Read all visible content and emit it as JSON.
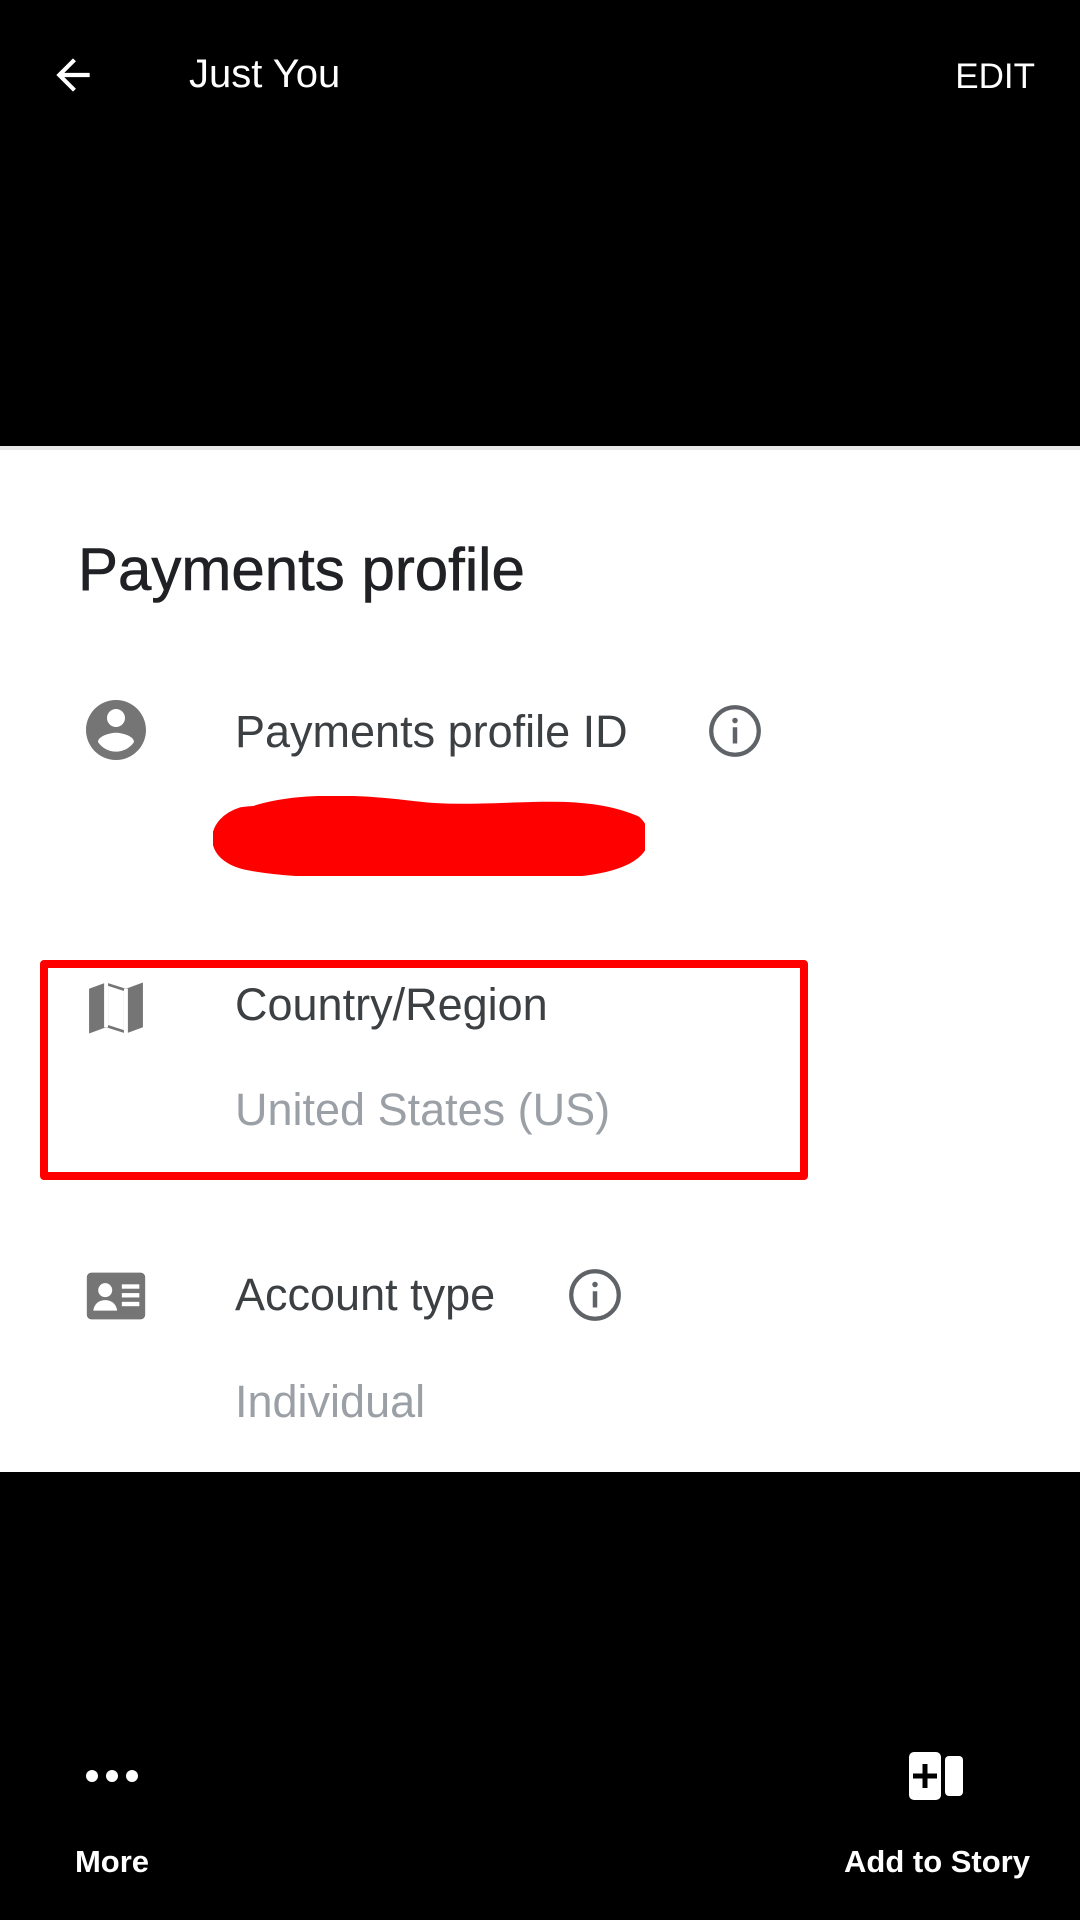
{
  "top_bar": {
    "title": "Just You",
    "edit_label": "EDIT",
    "back_icon": "arrow-left-icon"
  },
  "payments": {
    "section_title": "Payments profile",
    "profile_id": {
      "label": "Payments profile ID",
      "icon": "account-circle-icon",
      "info_icon": "info-icon",
      "value_redacted": true
    },
    "country": {
      "label": "Country/Region",
      "value": "United States (US)",
      "icon": "map-icon",
      "highlighted": true
    },
    "account_type": {
      "label": "Account type",
      "value": "Individual",
      "icon": "contact-card-icon",
      "info_icon": "info-icon"
    }
  },
  "bottom_bar": {
    "more_label": "More",
    "more_icon": "more-horizontal-icon",
    "story_label": "Add to Story",
    "story_icon": "add-to-story-icon"
  },
  "colors": {
    "background": "#000000",
    "panel": "#ffffff",
    "icon_gray": "#757575",
    "label_text": "#3c4043",
    "value_text": "#9aa0a6",
    "highlight": "#ff0000",
    "redaction": "#ff0000"
  }
}
